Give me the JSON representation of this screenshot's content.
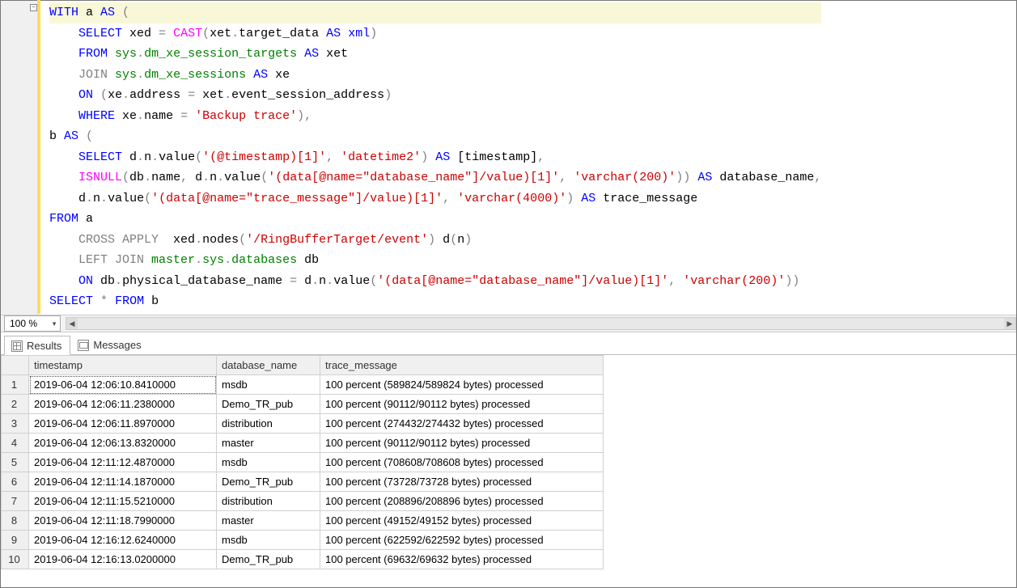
{
  "editor": {
    "fold_glyph": "−",
    "lines": [
      {
        "hl": true,
        "tokens": [
          {
            "c": "kw-blue",
            "t": "WITH"
          },
          {
            "c": "kw-black",
            "t": " a "
          },
          {
            "c": "kw-blue",
            "t": "AS"
          },
          {
            "c": "kw-gray",
            "t": " ("
          }
        ]
      },
      {
        "tokens": [
          {
            "c": "kw-black",
            "t": "    "
          },
          {
            "c": "kw-blue",
            "t": "SELECT"
          },
          {
            "c": "kw-black",
            "t": " xed "
          },
          {
            "c": "kw-gray",
            "t": "="
          },
          {
            "c": "kw-black",
            "t": " "
          },
          {
            "c": "kw-pink",
            "t": "CAST"
          },
          {
            "c": "kw-gray",
            "t": "("
          },
          {
            "c": "kw-black",
            "t": "xet"
          },
          {
            "c": "kw-gray",
            "t": "."
          },
          {
            "c": "kw-black",
            "t": "target_data "
          },
          {
            "c": "kw-blue",
            "t": "AS"
          },
          {
            "c": "kw-black",
            "t": " "
          },
          {
            "c": "kw-blue",
            "t": "xml"
          },
          {
            "c": "kw-gray",
            "t": ")"
          }
        ]
      },
      {
        "tokens": [
          {
            "c": "kw-black",
            "t": "    "
          },
          {
            "c": "kw-blue",
            "t": "FROM"
          },
          {
            "c": "kw-black",
            "t": " "
          },
          {
            "c": "kw-green",
            "t": "sys"
          },
          {
            "c": "kw-gray",
            "t": "."
          },
          {
            "c": "kw-green",
            "t": "dm_xe_session_targets"
          },
          {
            "c": "kw-black",
            "t": " "
          },
          {
            "c": "kw-blue",
            "t": "AS"
          },
          {
            "c": "kw-black",
            "t": " xet"
          }
        ]
      },
      {
        "tokens": [
          {
            "c": "kw-black",
            "t": "    "
          },
          {
            "c": "kw-gray",
            "t": "JOIN"
          },
          {
            "c": "kw-black",
            "t": " "
          },
          {
            "c": "kw-green",
            "t": "sys"
          },
          {
            "c": "kw-gray",
            "t": "."
          },
          {
            "c": "kw-green",
            "t": "dm_xe_sessions"
          },
          {
            "c": "kw-black",
            "t": " "
          },
          {
            "c": "kw-blue",
            "t": "AS"
          },
          {
            "c": "kw-black",
            "t": " xe"
          }
        ]
      },
      {
        "tokens": [
          {
            "c": "kw-black",
            "t": "    "
          },
          {
            "c": "kw-blue",
            "t": "ON"
          },
          {
            "c": "kw-black",
            "t": " "
          },
          {
            "c": "kw-gray",
            "t": "("
          },
          {
            "c": "kw-black",
            "t": "xe"
          },
          {
            "c": "kw-gray",
            "t": "."
          },
          {
            "c": "kw-black",
            "t": "address "
          },
          {
            "c": "kw-gray",
            "t": "="
          },
          {
            "c": "kw-black",
            "t": " xet"
          },
          {
            "c": "kw-gray",
            "t": "."
          },
          {
            "c": "kw-black",
            "t": "event_session_address"
          },
          {
            "c": "kw-gray",
            "t": ")"
          }
        ]
      },
      {
        "tokens": [
          {
            "c": "kw-black",
            "t": "    "
          },
          {
            "c": "kw-blue",
            "t": "WHERE"
          },
          {
            "c": "kw-black",
            "t": " xe"
          },
          {
            "c": "kw-gray",
            "t": "."
          },
          {
            "c": "kw-black",
            "t": "name "
          },
          {
            "c": "kw-gray",
            "t": "="
          },
          {
            "c": "kw-black",
            "t": " "
          },
          {
            "c": "kw-red",
            "t": "'Backup trace'"
          },
          {
            "c": "kw-gray",
            "t": "),"
          }
        ]
      },
      {
        "tokens": [
          {
            "c": "kw-black",
            "t": "b "
          },
          {
            "c": "kw-blue",
            "t": "AS"
          },
          {
            "c": "kw-gray",
            "t": " ("
          }
        ]
      },
      {
        "tokens": [
          {
            "c": "kw-black",
            "t": "    "
          },
          {
            "c": "kw-blue",
            "t": "SELECT"
          },
          {
            "c": "kw-black",
            "t": " d"
          },
          {
            "c": "kw-gray",
            "t": "."
          },
          {
            "c": "kw-black",
            "t": "n"
          },
          {
            "c": "kw-gray",
            "t": "."
          },
          {
            "c": "kw-black",
            "t": "value"
          },
          {
            "c": "kw-gray",
            "t": "("
          },
          {
            "c": "kw-red",
            "t": "'(@timestamp)[1]'"
          },
          {
            "c": "kw-gray",
            "t": ", "
          },
          {
            "c": "kw-red",
            "t": "'datetime2'"
          },
          {
            "c": "kw-gray",
            "t": ")"
          },
          {
            "c": "kw-black",
            "t": " "
          },
          {
            "c": "kw-blue",
            "t": "AS"
          },
          {
            "c": "kw-black",
            "t": " [timestamp]"
          },
          {
            "c": "kw-gray",
            "t": ","
          }
        ]
      },
      {
        "tokens": [
          {
            "c": "kw-black",
            "t": "    "
          },
          {
            "c": "kw-pink",
            "t": "ISNULL"
          },
          {
            "c": "kw-gray",
            "t": "("
          },
          {
            "c": "kw-black",
            "t": "db"
          },
          {
            "c": "kw-gray",
            "t": "."
          },
          {
            "c": "kw-black",
            "t": "name"
          },
          {
            "c": "kw-gray",
            "t": ", "
          },
          {
            "c": "kw-black",
            "t": "d"
          },
          {
            "c": "kw-gray",
            "t": "."
          },
          {
            "c": "kw-black",
            "t": "n"
          },
          {
            "c": "kw-gray",
            "t": "."
          },
          {
            "c": "kw-black",
            "t": "value"
          },
          {
            "c": "kw-gray",
            "t": "("
          },
          {
            "c": "kw-red",
            "t": "'(data[@name=\"database_name\"]/value)[1]'"
          },
          {
            "c": "kw-gray",
            "t": ", "
          },
          {
            "c": "kw-red",
            "t": "'varchar(200)'"
          },
          {
            "c": "kw-gray",
            "t": "))"
          },
          {
            "c": "kw-black",
            "t": " "
          },
          {
            "c": "kw-blue",
            "t": "AS"
          },
          {
            "c": "kw-black",
            "t": " database_name"
          },
          {
            "c": "kw-gray",
            "t": ","
          }
        ]
      },
      {
        "tokens": [
          {
            "c": "kw-black",
            "t": "    d"
          },
          {
            "c": "kw-gray",
            "t": "."
          },
          {
            "c": "kw-black",
            "t": "n"
          },
          {
            "c": "kw-gray",
            "t": "."
          },
          {
            "c": "kw-black",
            "t": "value"
          },
          {
            "c": "kw-gray",
            "t": "("
          },
          {
            "c": "kw-red",
            "t": "'(data[@name=\"trace_message\"]/value)[1]'"
          },
          {
            "c": "kw-gray",
            "t": ", "
          },
          {
            "c": "kw-red",
            "t": "'varchar(4000)'"
          },
          {
            "c": "kw-gray",
            "t": ")"
          },
          {
            "c": "kw-black",
            "t": " "
          },
          {
            "c": "kw-blue",
            "t": "AS"
          },
          {
            "c": "kw-black",
            "t": " trace_message"
          }
        ]
      },
      {
        "tokens": [
          {
            "c": "kw-blue",
            "t": "FROM"
          },
          {
            "c": "kw-black",
            "t": " a"
          }
        ]
      },
      {
        "tokens": [
          {
            "c": "kw-black",
            "t": "    "
          },
          {
            "c": "kw-gray",
            "t": "CROSS APPLY"
          },
          {
            "c": "kw-black",
            "t": "  xed"
          },
          {
            "c": "kw-gray",
            "t": "."
          },
          {
            "c": "kw-black",
            "t": "nodes"
          },
          {
            "c": "kw-gray",
            "t": "("
          },
          {
            "c": "kw-red",
            "t": "'/RingBufferTarget/event'"
          },
          {
            "c": "kw-gray",
            "t": ")"
          },
          {
            "c": "kw-black",
            "t": " d"
          },
          {
            "c": "kw-gray",
            "t": "("
          },
          {
            "c": "kw-black",
            "t": "n"
          },
          {
            "c": "kw-gray",
            "t": ")"
          }
        ]
      },
      {
        "tokens": [
          {
            "c": "kw-black",
            "t": "    "
          },
          {
            "c": "kw-gray",
            "t": "LEFT JOIN"
          },
          {
            "c": "kw-black",
            "t": " "
          },
          {
            "c": "kw-green",
            "t": "master"
          },
          {
            "c": "kw-gray",
            "t": "."
          },
          {
            "c": "kw-green",
            "t": "sys"
          },
          {
            "c": "kw-gray",
            "t": "."
          },
          {
            "c": "kw-green",
            "t": "databases"
          },
          {
            "c": "kw-black",
            "t": " db"
          }
        ]
      },
      {
        "tokens": [
          {
            "c": "kw-black",
            "t": "    "
          },
          {
            "c": "kw-blue",
            "t": "ON"
          },
          {
            "c": "kw-black",
            "t": " db"
          },
          {
            "c": "kw-gray",
            "t": "."
          },
          {
            "c": "kw-black",
            "t": "physical_database_name "
          },
          {
            "c": "kw-gray",
            "t": "="
          },
          {
            "c": "kw-black",
            "t": " d"
          },
          {
            "c": "kw-gray",
            "t": "."
          },
          {
            "c": "kw-black",
            "t": "n"
          },
          {
            "c": "kw-gray",
            "t": "."
          },
          {
            "c": "kw-black",
            "t": "value"
          },
          {
            "c": "kw-gray",
            "t": "("
          },
          {
            "c": "kw-red",
            "t": "'(data[@name=\"database_name\"]/value)[1]'"
          },
          {
            "c": "kw-gray",
            "t": ", "
          },
          {
            "c": "kw-red",
            "t": "'varchar(200)'"
          },
          {
            "c": "kw-gray",
            "t": "))"
          }
        ]
      },
      {
        "tokens": [
          {
            "c": "kw-blue",
            "t": "SELECT"
          },
          {
            "c": "kw-black",
            "t": " "
          },
          {
            "c": "kw-gray",
            "t": "*"
          },
          {
            "c": "kw-black",
            "t": " "
          },
          {
            "c": "kw-blue",
            "t": "FROM"
          },
          {
            "c": "kw-black",
            "t": " b"
          }
        ]
      }
    ]
  },
  "zoom": {
    "value": "100 %"
  },
  "tabs": {
    "results": "Results",
    "messages": "Messages"
  },
  "grid": {
    "columns": [
      "timestamp",
      "database_name",
      "trace_message"
    ],
    "rows": [
      [
        "2019-06-04 12:06:10.8410000",
        "msdb",
        "100 percent (589824/589824 bytes) processed"
      ],
      [
        "2019-06-04 12:06:11.2380000",
        "Demo_TR_pub",
        "100 percent (90112/90112 bytes) processed"
      ],
      [
        "2019-06-04 12:06:11.8970000",
        "distribution",
        "100 percent (274432/274432 bytes) processed"
      ],
      [
        "2019-06-04 12:06:13.8320000",
        "master",
        "100 percent (90112/90112 bytes) processed"
      ],
      [
        "2019-06-04 12:11:12.4870000",
        "msdb",
        "100 percent (708608/708608 bytes) processed"
      ],
      [
        "2019-06-04 12:11:14.1870000",
        "Demo_TR_pub",
        "100 percent (73728/73728 bytes) processed"
      ],
      [
        "2019-06-04 12:11:15.5210000",
        "distribution",
        "100 percent (208896/208896 bytes) processed"
      ],
      [
        "2019-06-04 12:11:18.7990000",
        "master",
        "100 percent (49152/49152 bytes) processed"
      ],
      [
        "2019-06-04 12:16:12.6240000",
        "msdb",
        "100 percent (622592/622592 bytes) processed"
      ],
      [
        "2019-06-04 12:16:13.0200000",
        "Demo_TR_pub",
        "100 percent (69632/69632 bytes) processed"
      ]
    ]
  }
}
